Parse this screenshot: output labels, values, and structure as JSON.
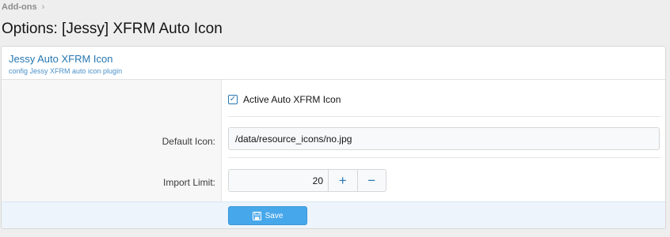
{
  "breadcrumb": {
    "item": "Add-ons"
  },
  "page": {
    "title": "Options: [Jessy] XFRM Auto Icon"
  },
  "block": {
    "title": "Jessy Auto XFRM Icon",
    "description": "config Jessy XFRM auto icon plugin"
  },
  "options": {
    "active": {
      "label": "Active Auto XFRM Icon",
      "checked": true
    },
    "default_icon": {
      "label": "Default Icon:",
      "value": "/data/resource_icons/no.jpg"
    },
    "import_limit": {
      "label": "Import Limit:",
      "value": "20",
      "plus": "+",
      "minus": "−"
    }
  },
  "footer": {
    "save_label": "Save"
  },
  "colors": {
    "accent": "#2577b1",
    "button": "#47a7eb",
    "footer_bg": "#edf4fb"
  },
  "icons": {
    "breadcrumb_separator": "chevron-right-icon",
    "save": "floppy-disk-icon",
    "checkbox": "check-icon"
  }
}
